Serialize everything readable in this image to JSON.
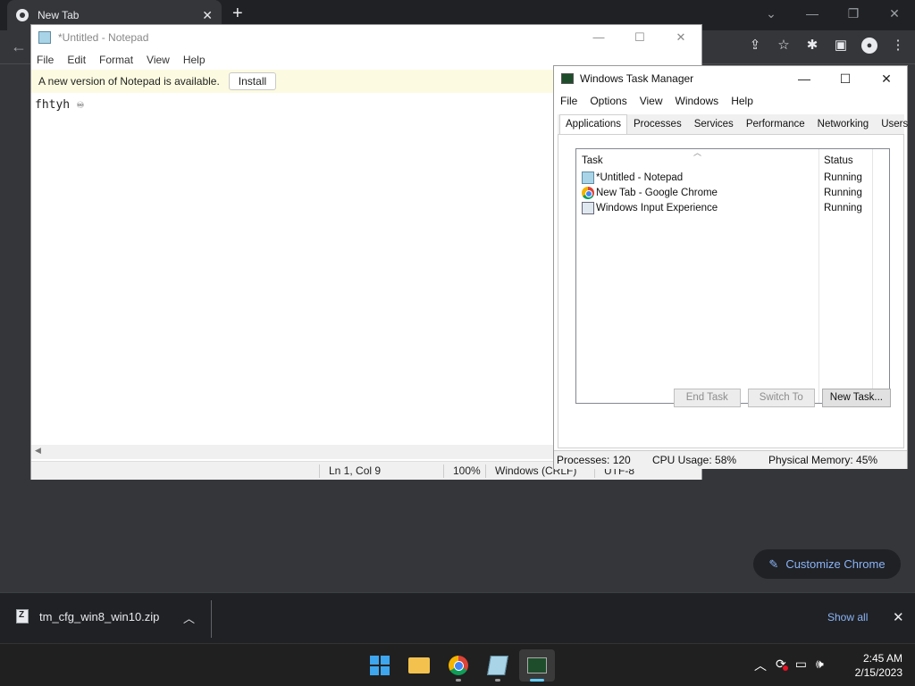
{
  "chrome": {
    "tab_title": "New Tab",
    "tab_close": "✕",
    "new_tab": "+",
    "back": "←",
    "customize_label": "Customize Chrome",
    "download": {
      "filename": "tm_cfg_win8_win10.zip",
      "show_all": "Show all"
    }
  },
  "notepad": {
    "title": "*Untitled - Notepad",
    "menu": [
      "File",
      "Edit",
      "Format",
      "View",
      "Help"
    ],
    "update_message": "A new version of Notepad is available.",
    "install_label": "Install",
    "content": "fhtyh ♾",
    "status": {
      "position": "Ln 1, Col 9",
      "zoom": "100%",
      "line_ending": "Windows (CRLF)",
      "encoding": "UTF-8"
    }
  },
  "taskmgr": {
    "title": "Windows Task Manager",
    "menu": [
      "File",
      "Options",
      "View",
      "Windows",
      "Help"
    ],
    "tabs": [
      "Applications",
      "Processes",
      "Services",
      "Performance",
      "Networking",
      "Users"
    ],
    "active_tab": "Applications",
    "columns": {
      "task": "Task",
      "status": "Status"
    },
    "rows": [
      {
        "name": "*Untitled - Notepad",
        "status": "Running",
        "icon": "notepad-icon"
      },
      {
        "name": "New Tab - Google Chrome",
        "status": "Running",
        "icon": "chrome-icon"
      },
      {
        "name": "Windows Input Experience",
        "status": "Running",
        "icon": "window-icon"
      }
    ],
    "buttons": {
      "end_task": "End Task",
      "switch_to": "Switch To",
      "new_task": "New Task..."
    },
    "status": {
      "processes": "Processes: 120",
      "cpu": "CPU Usage: 58%",
      "memory": "Physical Memory: 45%"
    }
  },
  "taskbar": {
    "time": "2:45 AM",
    "date": "2/15/2023"
  },
  "colors": {
    "chrome_bg": "#35363a",
    "accent_blue": "#8ab4f8",
    "taskbar": "#202020",
    "notepad_banner": "#fcfbe1"
  }
}
